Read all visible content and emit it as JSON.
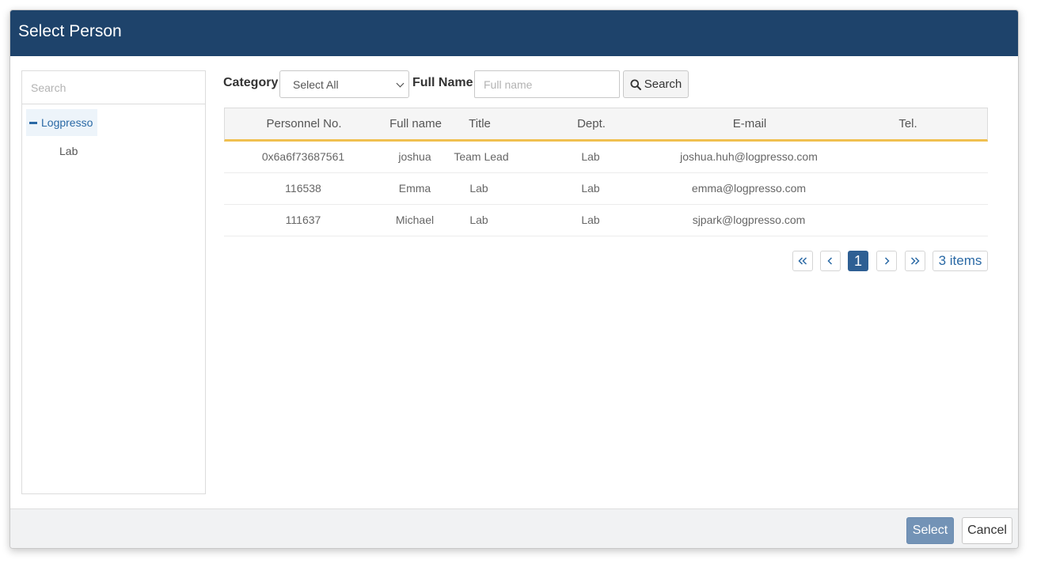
{
  "dialog": {
    "title": "Select Person",
    "header_color": "#1e436b"
  },
  "tree": {
    "search_placeholder": "Search",
    "root_label": "Logpresso",
    "children": [
      "Lab"
    ]
  },
  "filters": {
    "category_label": "Category",
    "category_selected": "Select All",
    "name_label": "Full Name",
    "name_placeholder": "Full name",
    "search_button": "Search"
  },
  "table": {
    "columns": [
      "Personnel No.",
      "Full name",
      "Title",
      "Dept.",
      "E-mail",
      "Tel."
    ],
    "rows": [
      [
        "0x6a6f73687561",
        "joshua",
        "Team Lead",
        "Lab",
        "joshua.huh@logpresso.com",
        ""
      ],
      [
        "116538",
        "Emma",
        "Lab",
        "Lab",
        "emma@logpresso.com",
        ""
      ],
      [
        "111637",
        "Michael",
        "Lab",
        "Lab",
        "sjpark@logpresso.com",
        ""
      ]
    ],
    "header_underline_color": "#f0c050"
  },
  "pager": {
    "current_page": "1",
    "item_count": "3 items",
    "icons": [
      "double-chevron-left-icon",
      "chevron-left-icon",
      "chevron-right-icon",
      "double-chevron-right-icon"
    ]
  },
  "footer": {
    "select_label": "Select",
    "cancel_label": "Cancel",
    "select_color": "#7393b6"
  }
}
